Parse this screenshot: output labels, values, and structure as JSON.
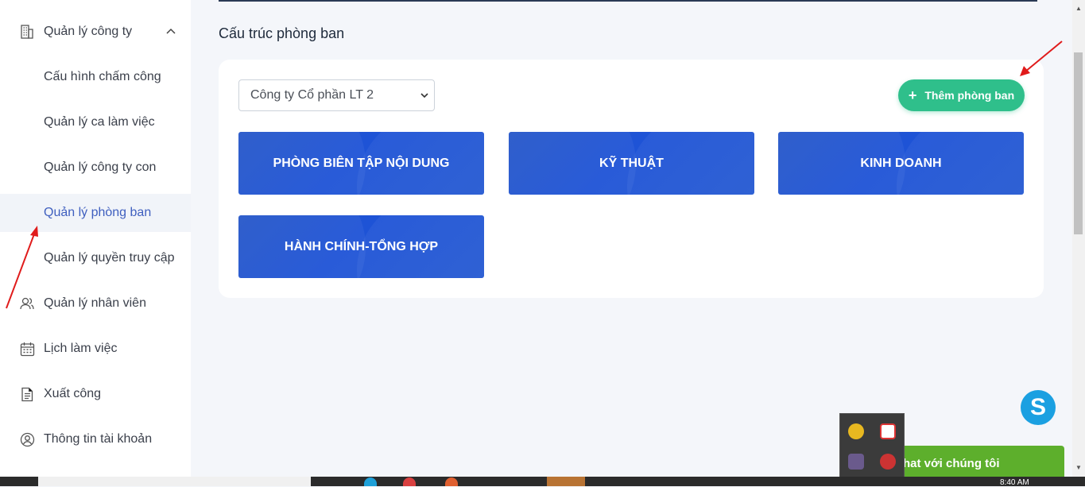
{
  "sidebar": {
    "company": "Quản lý công ty",
    "items": [
      {
        "label": "Cấu hình chấm công"
      },
      {
        "label": "Quản lý ca làm việc"
      },
      {
        "label": "Quản lý công ty con"
      },
      {
        "label": "Quản lý phòng ban"
      },
      {
        "label": "Quản lý quyền truy cập"
      },
      {
        "label": "Quản lý nhân viên"
      },
      {
        "label": "Lịch làm việc"
      },
      {
        "label": "Xuất công"
      },
      {
        "label": "Thông tin tài khoản"
      }
    ],
    "active_index": 3
  },
  "main": {
    "title": "Cấu trúc phòng ban",
    "company_select": "Công ty Cổ phần LT 2",
    "add_button": "Thêm phòng ban",
    "add_icon": "+",
    "departments": [
      "PHÒNG BIÊN TẬP NỘI DUNG",
      "KỸ THUẬT",
      "KINH DOANH",
      "HÀNH CHÍNH-TỔNG HỢP"
    ]
  },
  "widgets": {
    "skype_letter": "S",
    "chat_label": "hat với chúng tôi"
  },
  "taskbar": {
    "clock": "8:40 AM"
  },
  "colors": {
    "accent_green": "#2fbf8b",
    "department_blue": "#2557c9",
    "active_nav_text": "#3f5fbf",
    "chat_green": "#5daf2c",
    "annotation_red": "#e01b1b"
  }
}
